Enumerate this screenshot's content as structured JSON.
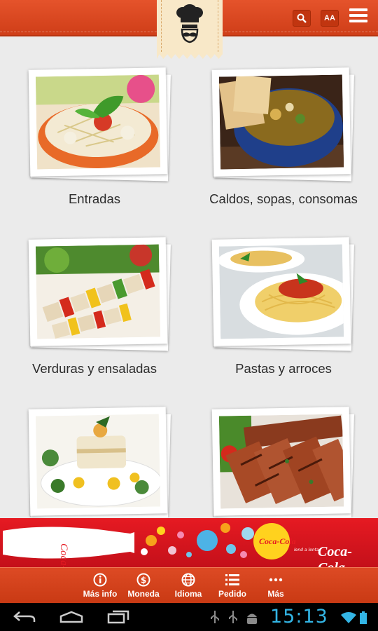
{
  "header": {
    "logo_icon": "chef-mustache-icon",
    "search_icon": "search-icon",
    "font_size_label": "AA",
    "menu_icon": "hamburger-menu-icon",
    "brand_color": "#d9441d"
  },
  "categories": [
    {
      "label": "Entradas",
      "image": "salad-bowl-photo"
    },
    {
      "label": "Caldos, sopas, consomas",
      "image": "soup-with-crackers-photo"
    },
    {
      "label": "Verduras y ensaladas",
      "image": "vegetable-skewers-photo"
    },
    {
      "label": "Pastas y arroces",
      "image": "spaghetti-plates-photo"
    },
    {
      "label": "",
      "image": "fish-fillet-photo"
    },
    {
      "label": "",
      "image": "grilled-steak-photo"
    }
  ],
  "ad": {
    "brand": "Coca-Cola",
    "tagline": "lend a lenta",
    "color": "#e61a22"
  },
  "toolbar": {
    "items": [
      {
        "label": "Más info",
        "icon": "info-icon"
      },
      {
        "label": "Moneda",
        "icon": "currency-icon"
      },
      {
        "label": "Idioma",
        "icon": "globe-icon"
      },
      {
        "label": "Pedido",
        "icon": "list-icon"
      },
      {
        "label": "Más",
        "icon": "more-dots-icon"
      }
    ]
  },
  "system": {
    "time": "15:13",
    "clock_color": "#33b5e5"
  }
}
